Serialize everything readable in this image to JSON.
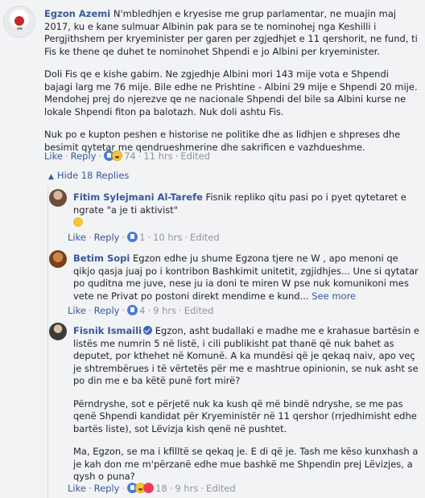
{
  "main_comment": {
    "author": "Egzon Azemi",
    "paragraphs": [
      " N'mbledhjen e kryesise me grup parlamentar, ne muajin maj 2017, ku e kane sulmuar Albinin pak para se te nominohej nga Keshilli i Pergjithshem per kryeminister per garen per zgjedhjet e 11 qershorit, ne fund, ti Fis ke thene qe duhet te nominohet Shpendi e jo Albini per kryeminister.",
      "Doli Fis qe e kishe gabim. Ne zgjedhje Albini mori 143 mije vota e Shpendi bajagi larg me 76 mije. Bile edhe ne Prishtine - Albini 29 mije e Shpendi 20 mije. Mendohej prej do njerezve qe ne nacionale Shpendi del bile sa Albini kurse ne lokale Shpendi fiton pa balotazh. Nuk doli ashtu Fis.",
      "Nuk po e kupton peshen e historise ne politike dhe as lidhjen e shpreses dhe besimit qytetar me qendrueshmerine dhe sakrificen e vazhdueshme."
    ],
    "actions": {
      "like": "Like",
      "reply": "Reply",
      "reactions": "74",
      "time": "11 hrs",
      "edited": "Edited"
    }
  },
  "hide_replies_label": "Hide 18 Replies",
  "replies": [
    {
      "author": "Fitim Sylejmani Al-Tarefe",
      "text": " Fisnik repliko qitu pasi po i pyet qytetaret e ngrate \"a je ti aktivist\"",
      "actions": {
        "like": "Like",
        "reply": "Reply",
        "reactions": "1",
        "time": "10 hrs",
        "edited": "Edited"
      }
    },
    {
      "author": "Betim Sopi",
      "text": " Egzon edhe ju shume Egzona tjere ne W , apo menoni qe qikjo qasja juaj po i kontribon Bashkimit unitetit, zgjidhjes... Une si qytatar po quditna me juve, nese ju ia doni te miren W pse nuk komunikoni mes vete ne Privat po postoni direkt mendime e kund...",
      "see_more": "See more",
      "actions": {
        "like": "Like",
        "reply": "Reply",
        "reactions": "4",
        "time": "9 hrs",
        "edited": "Edited"
      }
    },
    {
      "author": "Fisnik Ismaili",
      "paragraphs": [
        " Egzon, asht budallaki e madhe me e krahasue bartësin e listës me numrin 5 në listë, i cili publikisht pat thanë që nuk bahet as deputet, por kthehet në Komunë. A ka mundësi që je qekaq naiv, apo veç je shtrembërues i të vërtetës për me e mashtrue opinionin, se nuk asht se po din me e ba këtë punë fort mirë?",
        "Përndryshe, sot e përjetë nuk ka kush që më bindë ndryshe, se me pas qenë Shpendi kandidat për Kryeministër në 11 qershor (rrjedhimisht edhe bartës liste), sot Lëvizja kish qenë në pushtet.",
        "Ma, Egzon, se ma i kfilltë se qekaq je. E di që je. Tash me këso kunxhash a je kah don me m'përzanë edhe mue bashkë me Shpendin prej Lëvizjes, a qysh o puna?"
      ],
      "actions": {
        "like": "Like",
        "reply": "Reply",
        "reactions": "18",
        "time": "9 hrs",
        "edited": "Edited"
      }
    }
  ]
}
